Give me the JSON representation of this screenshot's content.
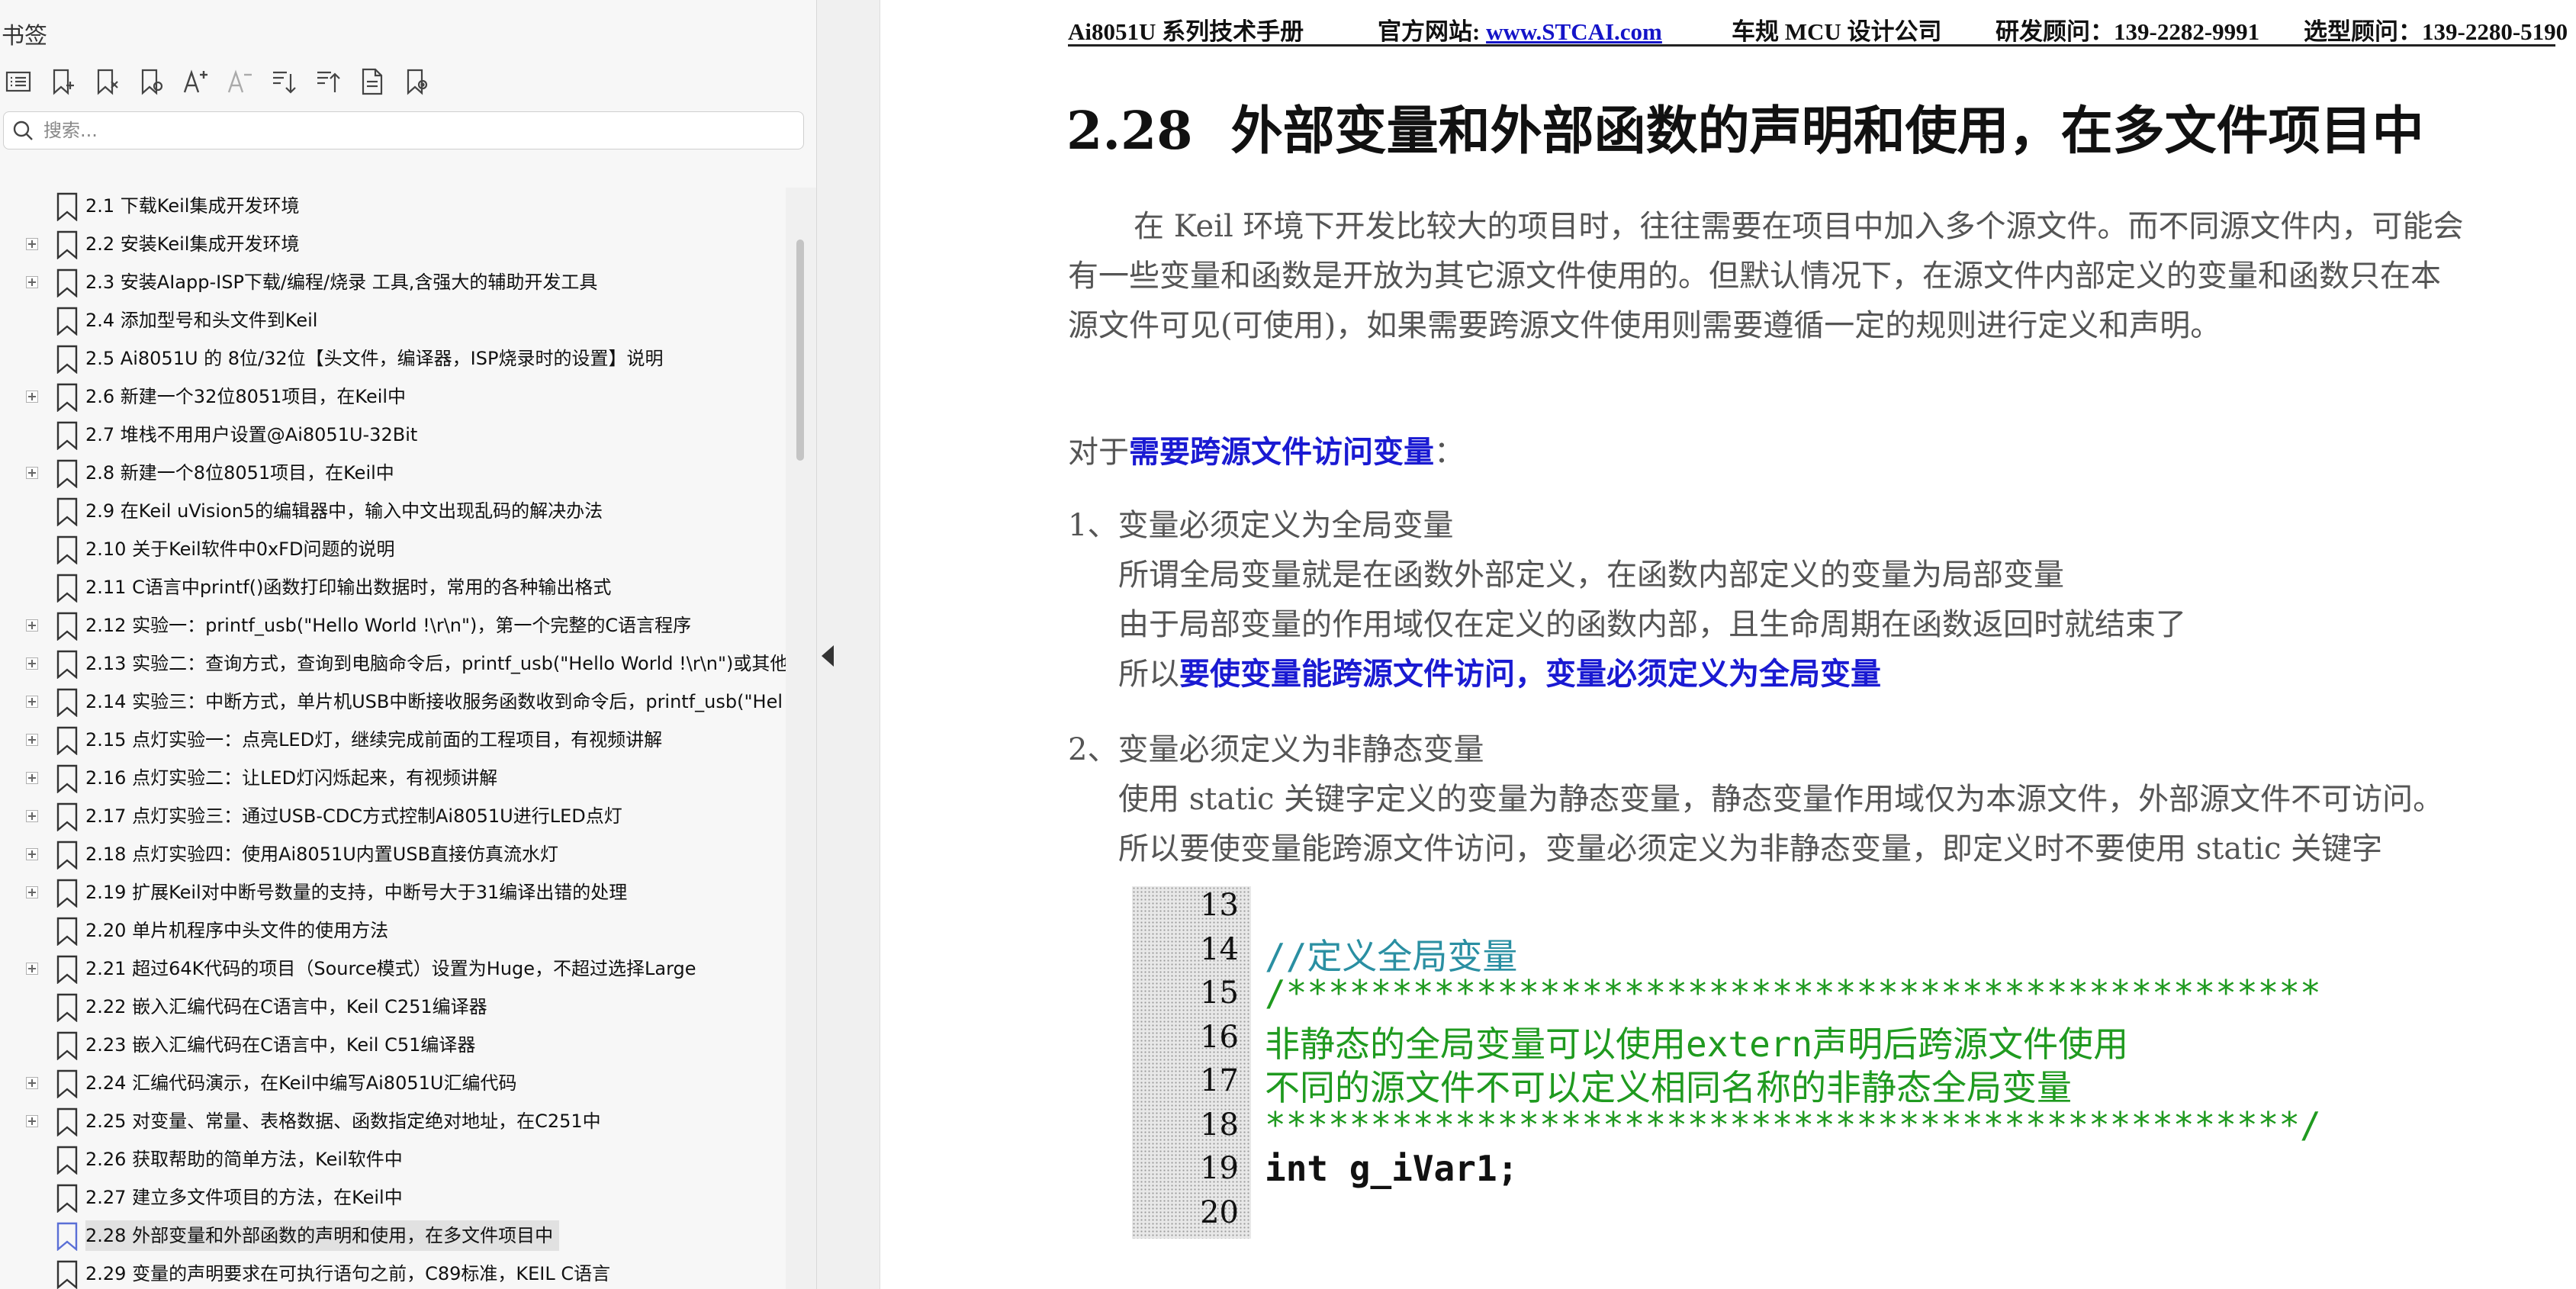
{
  "sidebar": {
    "title": "书签",
    "search_placeholder": "搜索...",
    "toolbar_icons": [
      "bookmark-list-icon",
      "add-bookmark-icon",
      "delete-bookmark-icon",
      "bookmark-properties-icon",
      "increase-font-icon",
      "decrease-font-icon",
      "expand-all-icon",
      "collapse-all-icon",
      "bookmark-document-icon",
      "locate-bookmark-icon"
    ],
    "items": [
      {
        "label": "2.1 下载Keil集成开发环境",
        "expandable": false,
        "active": false
      },
      {
        "label": "2.2  安装Keil集成开发环境",
        "expandable": true,
        "active": false
      },
      {
        "label": "2.3  安装AIapp-ISP下载/编程/烧录 工具,含强大的辅助开发工具",
        "expandable": true,
        "active": false
      },
      {
        "label": "2.4  添加型号和头文件到Keil",
        "expandable": false,
        "active": false
      },
      {
        "label": "2.5  Ai8051U 的 8位/32位【头文件，编译器，ISP烧录时的设置】说明",
        "expandable": false,
        "active": false
      },
      {
        "label": "2.6 新建一个32位8051项目，在Keil中",
        "expandable": true,
        "active": false
      },
      {
        "label": "2.7  堆栈不用用户设置@Ai8051U-32Bit",
        "expandable": false,
        "active": false
      },
      {
        "label": "2.8  新建一个8位8051项目，在Keil中",
        "expandable": true,
        "active": false
      },
      {
        "label": "2.9  在Keil uVision5的编辑器中，输入中文出现乱码的解决办法",
        "expandable": false,
        "active": false
      },
      {
        "label": "2.10  关于Keil软件中0xFD问题的说明",
        "expandable": false,
        "active": false
      },
      {
        "label": "2.11  C语言中printf()函数打印输出数据时，常用的各种输出格式",
        "expandable": false,
        "active": false
      },
      {
        "label": "2.12  实验一：printf_usb(\"Hello World !\\r\\n\")，第一个完整的C语言程序",
        "expandable": true,
        "active": false
      },
      {
        "label": "2.13  实验二：查询方式，查询到电脑命令后，printf_usb(\"Hello World !\\r\\n\")或其他",
        "expandable": true,
        "active": false
      },
      {
        "label": "2.14  实验三：中断方式，单片机USB中断接收服务函数收到命令后，printf_usb(\"Hel",
        "expandable": true,
        "active": false
      },
      {
        "label": "2.15  点灯实验一：点亮LED灯，继续完成前面的工程项目，有视频讲解",
        "expandable": true,
        "active": false
      },
      {
        "label": "2.16  点灯实验二：让LED灯闪烁起来，有视频讲解",
        "expandable": true,
        "active": false
      },
      {
        "label": "2.17  点灯实验三：通过USB-CDC方式控制Ai8051U进行LED点灯",
        "expandable": true,
        "active": false
      },
      {
        "label": "2.18  点灯实验四：使用Ai8051U内置USB直接仿真流水灯",
        "expandable": true,
        "active": false
      },
      {
        "label": "2.19  扩展Keil对中断号数量的支持，中断号大于31编译出错的处理",
        "expandable": true,
        "active": false
      },
      {
        "label": "2.20  单片机程序中头文件的使用方法",
        "expandable": false,
        "active": false
      },
      {
        "label": "2.21  超过64K代码的项目（Source模式）设置为Huge，不超过选择Large",
        "expandable": true,
        "active": false
      },
      {
        "label": "2.22  嵌入汇编代码在C语言中，Keil C251编译器",
        "expandable": false,
        "active": false
      },
      {
        "label": "2.23  嵌入汇编代码在C语言中，Keil C51编译器",
        "expandable": false,
        "active": false
      },
      {
        "label": "2.24  汇编代码演示，在Keil中编写Ai8051U汇编代码",
        "expandable": true,
        "active": false
      },
      {
        "label": "2.25  对变量、常量、表格数据、函数指定绝对地址，在C251中",
        "expandable": true,
        "active": false
      },
      {
        "label": "2.26  获取帮助的简单方法，Keil软件中",
        "expandable": false,
        "active": false
      },
      {
        "label": "2.27  建立多文件项目的方法，在Keil中",
        "expandable": false,
        "active": false
      },
      {
        "label": "2.28 外部变量和外部函数的声明和使用，在多文件项目中",
        "expandable": false,
        "active": true
      },
      {
        "label": "2.29  变量的声明要求在可执行语句之前，C89标准，KEIL C语言",
        "expandable": false,
        "active": false
      }
    ]
  },
  "page": {
    "header": {
      "manual": "Ai8051U 系列技术手册",
      "site_label": "官方网站: ",
      "site_url": "www.STCAI.com",
      "company": "车规 MCU 设计公司",
      "dev_contact": "研发顾问：139-2282-9991",
      "sel_contact": "选型顾问：139-2280-5190"
    },
    "heading_num": "2.28",
    "heading_text": "外部变量和外部函数的声明和使用，在多文件项目中",
    "intro_line1": "在 Keil 环境下开发比较大的项目时，往往需要在项目中加入多个源文件。而不同源文件内，可能会",
    "intro_line2": "有一些变量和函数是开放为其它源文件使用的。但默认情况下，在源文件内部定义的变量和函数只在本",
    "intro_line3": "源文件可见(可使用)，如果需要跨源文件使用则需要遵循一定的规则进行定义和声明。",
    "for_prefix": "对于",
    "for_emph": "需要跨源文件访问变量",
    "for_suffix": "：",
    "rule1_title": "1、变量必须定义为全局变量",
    "rule1_l1": "所谓全局变量就是在函数外部定义，在函数内部定义的变量为局部变量",
    "rule1_l2": "由于局部变量的作用域仅在定义的函数内部，且生命周期在函数返回时就结束了",
    "rule1_l3_prefix": "所以",
    "rule1_l3_emph": "要使变量能跨源文件访问，变量必须定义为全局变量",
    "rule2_title": "2、变量必须定义为非静态变量",
    "rule2_l1": "使用 static 关键字定义的变量为静态变量，静态变量作用域仅为本源文件，外部源文件不可访问。",
    "rule2_l2": "所以要使变量能跨源文件访问，变量必须定义为非静态变量，即定义时不要使用 static 关键字",
    "code": {
      "lines": [
        {
          "n": "13",
          "text": ""
        },
        {
          "n": "14",
          "text": "//定义全局变量",
          "style": "teal"
        },
        {
          "n": "15",
          "text": "/*************************************************",
          "style": "green"
        },
        {
          "n": "16",
          "text": "非静态的全局变量可以使用extern声明后跨源文件使用",
          "style": "green"
        },
        {
          "n": "17",
          "text": "不同的源文件不可以定义相同名称的非静态全局变量",
          "style": "green"
        },
        {
          "n": "18",
          "text": "*************************************************/",
          "style": "green"
        },
        {
          "n": "19",
          "text": "int g_iVar1;",
          "style": "black"
        },
        {
          "n": "20",
          "text": ""
        }
      ]
    }
  }
}
